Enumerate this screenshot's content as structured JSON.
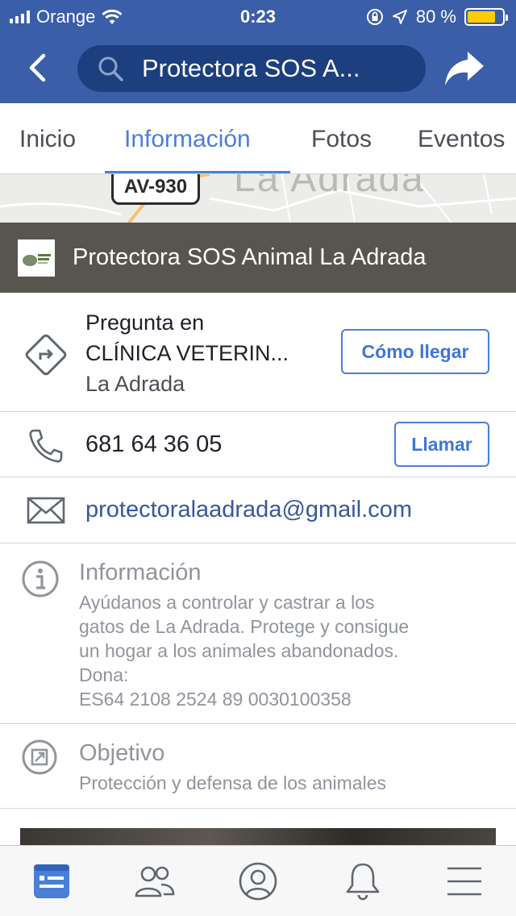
{
  "status_bar": {
    "carrier": "Orange",
    "time": "0:23",
    "battery_percent": "80 %",
    "battery_level": 0.8,
    "icons": [
      "signal-icon",
      "wifi-icon",
      "orientation-lock-icon",
      "location-arrow-icon",
      "battery-icon"
    ]
  },
  "header": {
    "search_text": "Protectora SOS A...",
    "icons": [
      "back-chevron-icon",
      "search-icon",
      "share-arrow-icon"
    ]
  },
  "tabs": [
    {
      "label": "Inicio",
      "active": false
    },
    {
      "label": "Información",
      "active": true
    },
    {
      "label": "Fotos",
      "active": false
    },
    {
      "label": "Eventos",
      "active": false
    }
  ],
  "map": {
    "town_label": "La Adrada",
    "road_label": "AV-930"
  },
  "page": {
    "name": "Protectora SOS Animal La Adrada"
  },
  "directions": {
    "line1": "Pregunta en",
    "line2": "CLÍNICA VETERIN...",
    "line3": "La Adrada",
    "button": "Cómo llegar"
  },
  "phone": {
    "number": "681 64 36 05",
    "button": "Llamar"
  },
  "email": {
    "address": "protectoralaadrada@gmail.com"
  },
  "about": {
    "title": "Información",
    "lines": [
      "Ayúdanos a  controlar y castrar a los",
      "gatos de La Adrada. Protege y consigue",
      "un hogar a los animales abandonados.",
      "Dona:",
      "ES64 2108 2524 89 0030100358"
    ]
  },
  "goal": {
    "title": "Objetivo",
    "text": "Protección y defensa de los animales"
  },
  "bottom_nav": {
    "items": [
      "news-feed-icon",
      "friends-icon",
      "profile-icon",
      "notifications-bell-icon",
      "menu-icon"
    ],
    "active": "news-feed-icon"
  },
  "colors": {
    "brand_blue": "#3b5ea8",
    "accent_blue": "#4a7fd8",
    "link_blue": "#385898"
  }
}
